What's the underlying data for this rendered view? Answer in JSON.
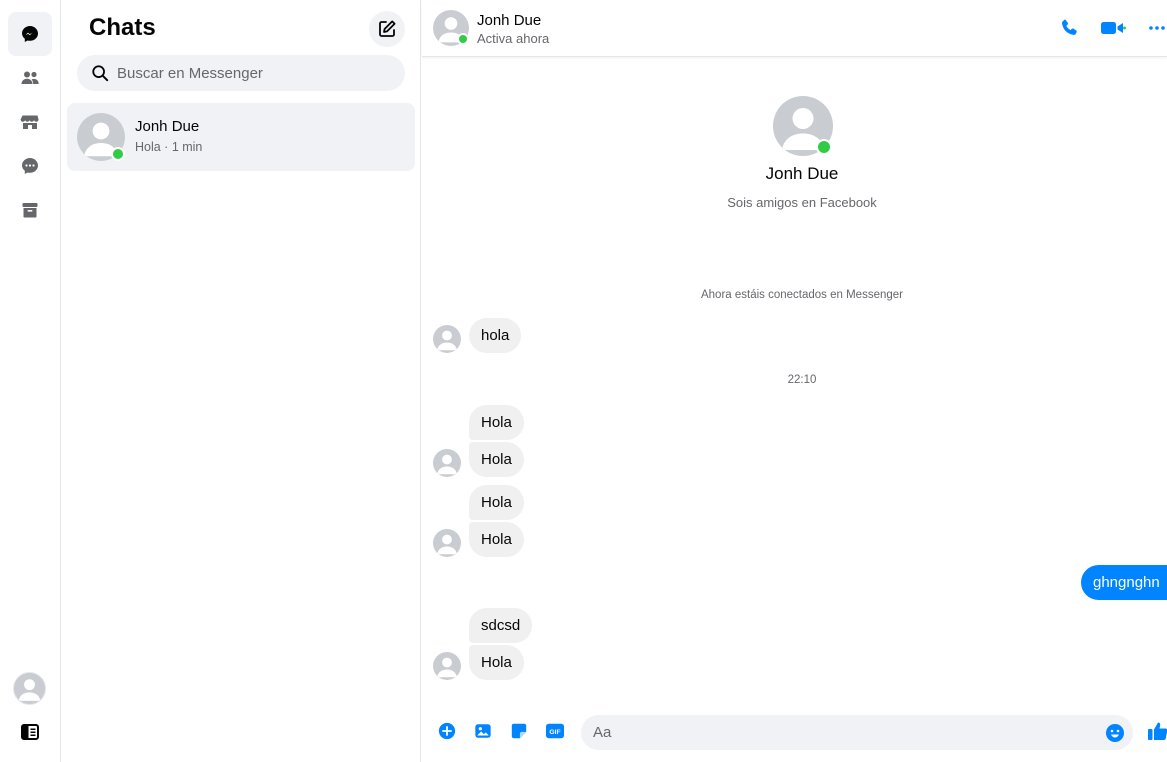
{
  "rail": {
    "items": [
      {
        "name": "chats",
        "icon": "chat-bubble-icon",
        "active": true
      },
      {
        "name": "people",
        "icon": "people-icon",
        "active": false
      },
      {
        "name": "marketplace",
        "icon": "store-icon",
        "active": false
      },
      {
        "name": "requests",
        "icon": "message-requests-icon",
        "active": false
      },
      {
        "name": "archive",
        "icon": "archive-icon",
        "active": false
      }
    ],
    "sidebar_toggle_icon": "sidebar-toggle-icon"
  },
  "list": {
    "title": "Chats",
    "search_placeholder": "Buscar en Messenger",
    "conversations": [
      {
        "name": "Jonh Due",
        "preview": "Hola · 1 min",
        "online": true
      }
    ]
  },
  "conversation": {
    "header": {
      "name": "Jonh Due",
      "status": "Activa ahora"
    },
    "profile": {
      "name": "Jonh Due",
      "subtitle": "Sois amigos en Facebook"
    },
    "system_note": "Ahora estáis conectados en Messenger",
    "timestamp": "22:10",
    "messages": [
      {
        "from": "them",
        "text": "hola"
      },
      {
        "from": "them",
        "text": "Hola"
      },
      {
        "from": "them",
        "text": "Hola"
      },
      {
        "from": "them",
        "text": "Hola"
      },
      {
        "from": "them",
        "text": "Hola"
      },
      {
        "from": "me",
        "text": "ghngnghn"
      },
      {
        "from": "them",
        "text": "sdcsd"
      },
      {
        "from": "them",
        "text": "Hola"
      }
    ],
    "composer": {
      "placeholder": "Aa",
      "icons": [
        "plus-circle-icon",
        "image-icon",
        "sticker-icon",
        "gif-icon",
        "emoji-icon",
        "like-icon"
      ]
    }
  },
  "colors": {
    "accent": "#0084ff",
    "online": "#31cc46",
    "bubble_in": "#f0f0f0",
    "muted_text": "#65676b"
  }
}
